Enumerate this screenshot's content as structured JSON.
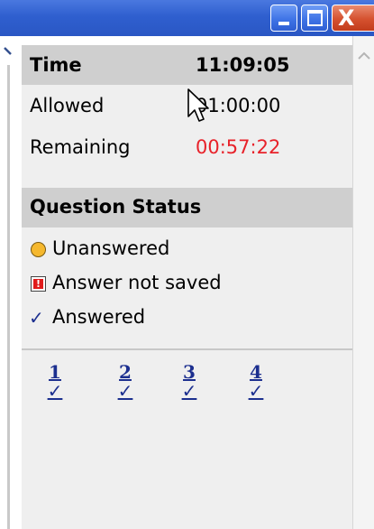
{
  "window": {
    "controls": {
      "minimize_icon": "minimize-icon",
      "maximize_icon": "maximize-icon",
      "close_icon": "close-icon",
      "close_glyph": "X"
    }
  },
  "time": {
    "label": "Time",
    "current": "11:09:05",
    "allowed_label": "Allowed",
    "allowed_value": "01:00:00",
    "remaining_label": "Remaining",
    "remaining_value": "00:57:22",
    "remaining_color": "#e8222a"
  },
  "question_status": {
    "header": "Question Status",
    "legend": [
      {
        "icon": "circle-icon",
        "label": "Unanswered",
        "color": "#f5b82e"
      },
      {
        "icon": "warning-icon",
        "label": "Answer not saved",
        "color": "#e01b1b"
      },
      {
        "icon": "check-icon",
        "label": "Answered",
        "color": "#1c2f8f"
      }
    ],
    "questions": [
      {
        "number": "1",
        "status": "answered"
      },
      {
        "number": "2",
        "status": "answered"
      },
      {
        "number": "3",
        "status": "answered"
      },
      {
        "number": "4",
        "status": "answered"
      }
    ]
  },
  "glyphs": {
    "warning": "!",
    "check": "✓"
  },
  "colors": {
    "link": "#1c2f8f",
    "header_bg": "#cfcfcf",
    "panel_bg": "#efefef",
    "titlebar": "#2f5fcf"
  }
}
